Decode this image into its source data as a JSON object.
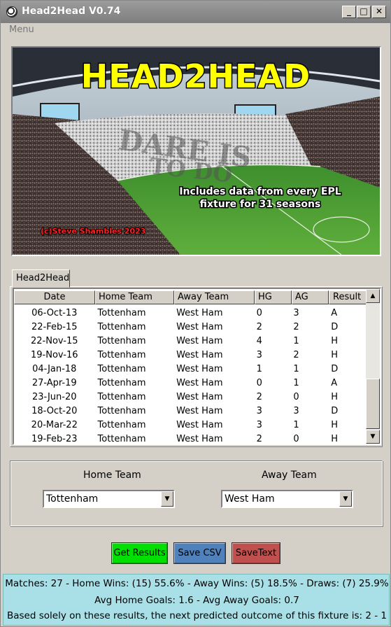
{
  "window": {
    "title": "Head2Head V0.74",
    "buttons": {
      "minimize": "_",
      "maximize": "□",
      "close": "✕"
    }
  },
  "menu": {
    "label": "Menu"
  },
  "banner": {
    "heading": "HEAD2HEAD",
    "tagline_line1": "Includes data from every EPL",
    "tagline_line2": "fixture for 31 seasons",
    "credit": "(c)Steve Shambles 2023",
    "crowd_banner_line1": "DARE IS",
    "crowd_banner_line2": "TO DO"
  },
  "tab": {
    "label": "Head2Head"
  },
  "table": {
    "columns": [
      "Date",
      "Home Team",
      "Away Team",
      "HG",
      "AG",
      "Result"
    ],
    "rows": [
      [
        "06-Oct-13",
        "Tottenham",
        "West Ham",
        "0",
        "3",
        "A"
      ],
      [
        "22-Feb-15",
        "Tottenham",
        "West Ham",
        "2",
        "2",
        "D"
      ],
      [
        "22-Nov-15",
        "Tottenham",
        "West Ham",
        "4",
        "1",
        "H"
      ],
      [
        "19-Nov-16",
        "Tottenham",
        "West Ham",
        "3",
        "2",
        "H"
      ],
      [
        "04-Jan-18",
        "Tottenham",
        "West Ham",
        "1",
        "1",
        "D"
      ],
      [
        "27-Apr-19",
        "Tottenham",
        "West Ham",
        "0",
        "1",
        "A"
      ],
      [
        "23-Jun-20",
        "Tottenham",
        "West Ham",
        "2",
        "0",
        "H"
      ],
      [
        "18-Oct-20",
        "Tottenham",
        "West Ham",
        "3",
        "3",
        "D"
      ],
      [
        "20-Mar-22",
        "Tottenham",
        "West Ham",
        "3",
        "1",
        "H"
      ],
      [
        "19-Feb-23",
        "Tottenham",
        "West Ham",
        "2",
        "0",
        "H"
      ]
    ],
    "scroll_up": "▲",
    "scroll_down": "▼"
  },
  "selection": {
    "home_label": "Home Team",
    "away_label": "Away Team",
    "home_value": "Tottenham",
    "away_value": "West Ham",
    "dropdown_glyph": "▼"
  },
  "actions": {
    "get_results": "Get Results",
    "save_csv": "Save  CSV",
    "save_text": "SaveText",
    "colors": {
      "get_results": "#00e000",
      "save_csv": "#4f81bd",
      "save_text": "#c0504d"
    }
  },
  "status": {
    "line1": "Matches: 27  -  Home Wins: (15) 55.6%  -  Away Wins: (5) 18.5%  -  Draws: (7) 25.9%",
    "line2": "Avg Home Goals: 1.6 - Avg Away Goals: 0.7",
    "line3": "Based solely on these results, the next predicted outcome of this fixture is: 2 - 1"
  }
}
